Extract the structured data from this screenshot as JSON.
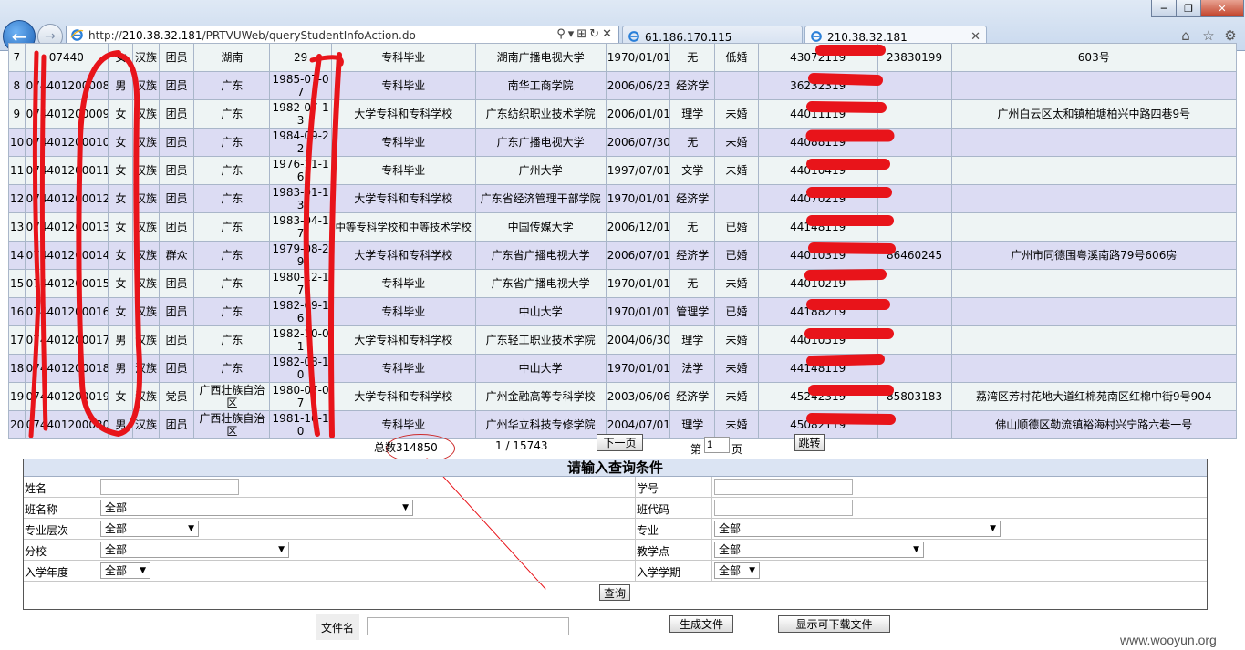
{
  "browser": {
    "url_prefix": "http://",
    "url_host": "210.38.32.181",
    "url_path": "/PRTVUWeb/queryStudentInfoAction.do",
    "tabs": [
      {
        "label": "61.186.170.115"
      },
      {
        "label": "210.38.32.181"
      }
    ],
    "window_buttons": {
      "minimize": "─",
      "maximize": "❐",
      "close": "✕"
    },
    "icons": {
      "home": "home-icon",
      "favorites": "star-icon",
      "settings": "gear-icon"
    }
  },
  "table": {
    "rows": [
      [
        "7",
        "07440",
        "",
        "女",
        "汉族",
        "团员",
        "湖南",
        "29",
        "专科毕业",
        "湖南广播电视大学",
        "1970/01/01",
        "无",
        "低婚",
        "43072119",
        "23830199",
        "603号"
      ],
      [
        "8",
        "074401200008",
        "",
        "男",
        "汉族",
        "团员",
        "广东",
        "1985-07-07",
        "专科毕业",
        "南华工商学院",
        "2006/06/23",
        "经济学",
        "",
        "36232319",
        "",
        ""
      ],
      [
        "9",
        "074401200009",
        "",
        "女",
        "汉族",
        "团员",
        "广东",
        "1982-07-13",
        "大学专科和专科学校",
        "广东纺织职业技术学院",
        "2006/01/01",
        "理学",
        "未婚",
        "44011119",
        "",
        "广州白云区太和镇柏塘柏兴中路四巷9号"
      ],
      [
        "10",
        "074401200010",
        "",
        "女",
        "汉族",
        "团员",
        "广东",
        "1984-09-22",
        "专科毕业",
        "广东广播电视大学",
        "2006/07/30",
        "无",
        "未婚",
        "44088119",
        "",
        ""
      ],
      [
        "11",
        "074401200011",
        "",
        "女",
        "汉族",
        "团员",
        "广东",
        "1976-11-16",
        "专科毕业",
        "广州大学",
        "1997/07/01",
        "文学",
        "未婚",
        "44010419",
        "",
        ""
      ],
      [
        "12",
        "074401200012",
        "",
        "女",
        "汉族",
        "团员",
        "广东",
        "1983-01-13",
        "大学专科和专科学校",
        "广东省经济管理干部学院",
        "1970/01/01",
        "经济学",
        "",
        "44070219",
        "",
        ""
      ],
      [
        "13",
        "074401200013",
        "",
        "女",
        "汉族",
        "团员",
        "广东",
        "1983-04-17",
        "中等专科学校和中等技术学校",
        "中国传媒大学",
        "2006/12/01",
        "无",
        "已婚",
        "44148119",
        "",
        ""
      ],
      [
        "14",
        "074401200014",
        "",
        "女",
        "汉族",
        "群众",
        "广东",
        "1979-08-29",
        "大学专科和专科学校",
        "广东省广播电视大学",
        "2006/07/01",
        "经济学",
        "已婚",
        "44010319",
        "86460245",
        "广州市同德围粤溪南路79号606房"
      ],
      [
        "15",
        "074401200015",
        "",
        "女",
        "汉族",
        "团员",
        "广东",
        "1980-12-17",
        "专科毕业",
        "广东省广播电视大学",
        "1970/01/01",
        "无",
        "未婚",
        "44010219",
        "",
        ""
      ],
      [
        "16",
        "074401200016",
        "",
        "女",
        "汉族",
        "团员",
        "广东",
        "1982-09-16",
        "专科毕业",
        "中山大学",
        "1970/01/01",
        "管理学",
        "已婚",
        "44188219",
        "",
        ""
      ],
      [
        "17",
        "074401200017",
        "",
        "男",
        "汉族",
        "团员",
        "广东",
        "1982-10-01",
        "大学专科和专科学校",
        "广东轻工职业技术学院",
        "2004/06/30",
        "理学",
        "未婚",
        "44010519",
        "",
        ""
      ],
      [
        "18",
        "074401200018",
        "",
        "男",
        "汉族",
        "团员",
        "广东",
        "1982-08-10",
        "专科毕业",
        "中山大学",
        "1970/01/01",
        "法学",
        "未婚",
        "44148119",
        "",
        ""
      ],
      [
        "19",
        "074401200019",
        "",
        "女",
        "汉族",
        "党员",
        "广西壮族自治区",
        "1980-07-07",
        "大学专科和专科学校",
        "广州金融高等专科学校",
        "2003/06/06",
        "经济学",
        "未婚",
        "45242319",
        "85803183",
        "荔湾区芳村花地大道红棉苑南区红棉中街9号904"
      ],
      [
        "20",
        "074401200020",
        "",
        "男",
        "汉族",
        "团员",
        "广西壮族自治区",
        "1981-10-10",
        "专科毕业",
        "广州华立科技专修学院",
        "2004/07/01",
        "理学",
        "未婚",
        "45082119",
        "",
        "佛山顺德区勒流镇裕海村兴宁路六巷一号"
      ]
    ]
  },
  "pager": {
    "total_label": "总数314850",
    "page_info": "1 / 15743",
    "next_label": "下一页",
    "page_prefix": "第",
    "page_value": "1",
    "page_suffix": "页",
    "jump_label": "跳转"
  },
  "form": {
    "title": "请输入查询条件",
    "name_label": "姓名",
    "student_no_label": "学号",
    "class_name_label": "班名称",
    "class_name_value": "全部",
    "class_code_label": "班代码",
    "level_label": "专业层次",
    "level_value": "全部",
    "major_label": "专业",
    "major_value": "全部",
    "branch_label": "分校",
    "branch_value": "全部",
    "site_label": "教学点",
    "site_value": "全部",
    "year_label": "入学年度",
    "year_value": "全部",
    "term_label": "入学学期",
    "term_value": "全部",
    "query_label": "查询"
  },
  "file": {
    "name_label": "文件名",
    "generate_label": "生成文件",
    "download_label": "显示可下载文件"
  },
  "watermark": "www.wooyun.org",
  "colors": {
    "odd_row": "#dcdcf3",
    "even_row": "#eef4f4",
    "annotation_red": "#e8141a"
  }
}
